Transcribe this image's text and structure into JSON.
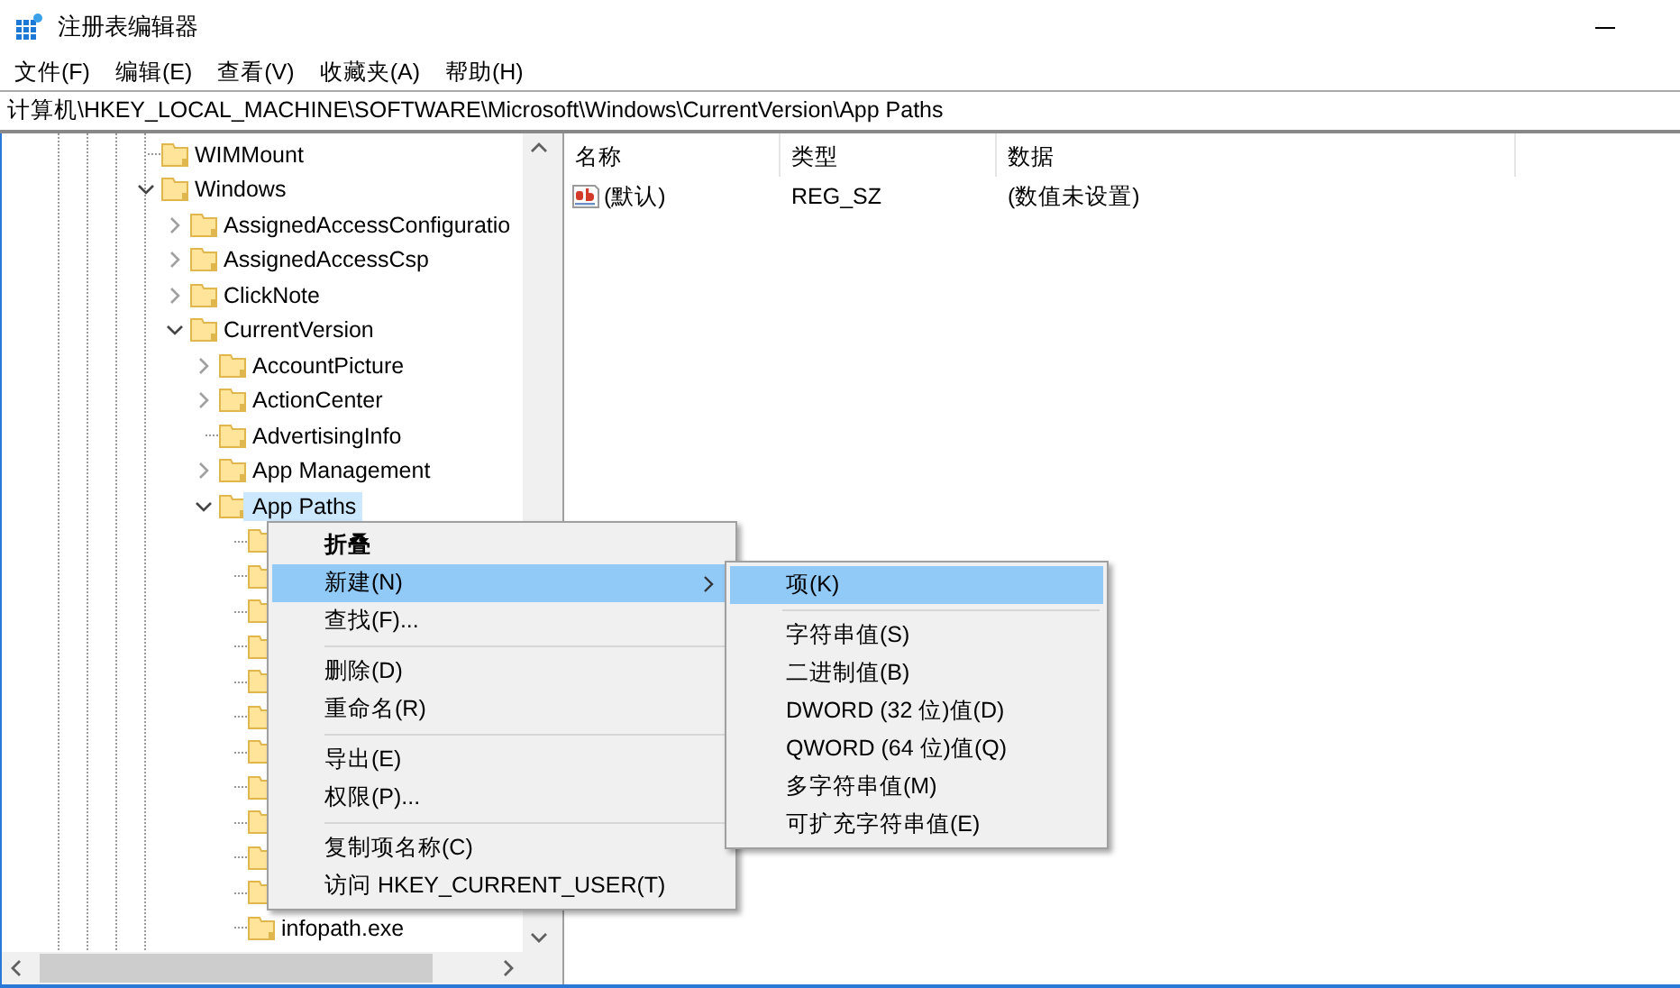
{
  "window": {
    "title": "注册表编辑器"
  },
  "menu_bar": [
    "文件(F)",
    "编辑(E)",
    "查看(V)",
    "收藏夹(A)",
    "帮助(H)"
  ],
  "address_bar": {
    "value": "计算机\\HKEY_LOCAL_MACHINE\\SOFTWARE\\Microsoft\\Windows\\CurrentVersion\\App Paths"
  },
  "tree": {
    "items": [
      {
        "label": "WIMMount",
        "kind": "leaf",
        "expanded": false,
        "selected": false
      },
      {
        "label": "Windows",
        "kind": "branch",
        "expanded": true,
        "selected": false,
        "children": [
          {
            "label": "AssignedAccessConfiguratio",
            "kind": "branch",
            "expanded": false,
            "selected": false
          },
          {
            "label": "AssignedAccessCsp",
            "kind": "branch",
            "expanded": false,
            "selected": false
          },
          {
            "label": "ClickNote",
            "kind": "branch",
            "expanded": false,
            "selected": false
          },
          {
            "label": "CurrentVersion",
            "kind": "branch",
            "expanded": true,
            "selected": false,
            "children": [
              {
                "label": "AccountPicture",
                "kind": "branch",
                "expanded": false,
                "selected": false
              },
              {
                "label": "ActionCenter",
                "kind": "branch",
                "expanded": false,
                "selected": false
              },
              {
                "label": "AdvertisingInfo",
                "kind": "leaf",
                "expanded": false,
                "selected": false
              },
              {
                "label": "App Management",
                "kind": "branch",
                "expanded": false,
                "selected": false
              },
              {
                "label": "App Paths",
                "kind": "branch",
                "expanded": true,
                "selected": true,
                "children": [
                  {
                    "kind": "leaf",
                    "expanded": false,
                    "selected": false
                  },
                  {
                    "kind": "leaf",
                    "expanded": false,
                    "selected": false
                  },
                  {
                    "kind": "leaf",
                    "expanded": false,
                    "selected": false
                  },
                  {
                    "kind": "leaf",
                    "expanded": false,
                    "selected": false
                  },
                  {
                    "kind": "leaf",
                    "expanded": false,
                    "selected": false
                  },
                  {
                    "kind": "leaf",
                    "expanded": false,
                    "selected": false
                  },
                  {
                    "kind": "leaf",
                    "expanded": false,
                    "selected": false
                  },
                  {
                    "kind": "leaf",
                    "expanded": false,
                    "selected": false
                  },
                  {
                    "kind": "leaf",
                    "expanded": false,
                    "selected": false
                  },
                  {
                    "kind": "leaf",
                    "expanded": false,
                    "selected": false
                  },
                  {
                    "kind": "leaf",
                    "expanded": false,
                    "selected": false
                  },
                  {
                    "label": "infopath.exe",
                    "kind": "leaf",
                    "expanded": false,
                    "selected": false
                  }
                ]
              }
            ]
          }
        ]
      }
    ]
  },
  "values_list": {
    "columns": [
      "名称",
      "类型",
      "数据"
    ],
    "rows": [
      {
        "name": "(默认)",
        "type": "REG_SZ",
        "data": "(数值未设置)"
      }
    ]
  },
  "context_menu": {
    "items": [
      {
        "kind": "item",
        "label": "折叠",
        "default": true,
        "selected": false,
        "submenu": false
      },
      {
        "kind": "item",
        "label": "新建(N)",
        "default": false,
        "selected": true,
        "submenu": true
      },
      {
        "kind": "item",
        "label": "查找(F)...",
        "default": false,
        "selected": false,
        "submenu": false
      },
      {
        "kind": "separator"
      },
      {
        "kind": "item",
        "label": "删除(D)",
        "default": false,
        "selected": false,
        "submenu": false
      },
      {
        "kind": "item",
        "label": "重命名(R)",
        "default": false,
        "selected": false,
        "submenu": false
      },
      {
        "kind": "separator"
      },
      {
        "kind": "item",
        "label": "导出(E)",
        "default": false,
        "selected": false,
        "submenu": false
      },
      {
        "kind": "item",
        "label": "权限(P)...",
        "default": false,
        "selected": false,
        "submenu": false
      },
      {
        "kind": "separator"
      },
      {
        "kind": "item",
        "label": "复制项名称(C)",
        "default": false,
        "selected": false,
        "submenu": false
      },
      {
        "kind": "item",
        "label": "访问 HKEY_CURRENT_USER(T)",
        "default": false,
        "selected": false,
        "submenu": false
      }
    ]
  },
  "submenu": {
    "items": [
      {
        "kind": "item",
        "label": "项(K)",
        "default": false,
        "selected": true,
        "submenu": false
      },
      {
        "kind": "separator"
      },
      {
        "kind": "item",
        "label": "字符串值(S)",
        "default": false,
        "selected": false,
        "submenu": false
      },
      {
        "kind": "item",
        "label": "二进制值(B)",
        "default": false,
        "selected": false,
        "submenu": false
      },
      {
        "kind": "item",
        "label": "DWORD (32 位)值(D)",
        "default": false,
        "selected": false,
        "submenu": false
      },
      {
        "kind": "item",
        "label": "QWORD (64 位)值(Q)",
        "default": false,
        "selected": false,
        "submenu": false
      },
      {
        "kind": "item",
        "label": "多字符串值(M)",
        "default": false,
        "selected": false,
        "submenu": false
      },
      {
        "kind": "item",
        "label": "可扩充字符串值(E)",
        "default": false,
        "selected": false,
        "submenu": false
      }
    ]
  }
}
